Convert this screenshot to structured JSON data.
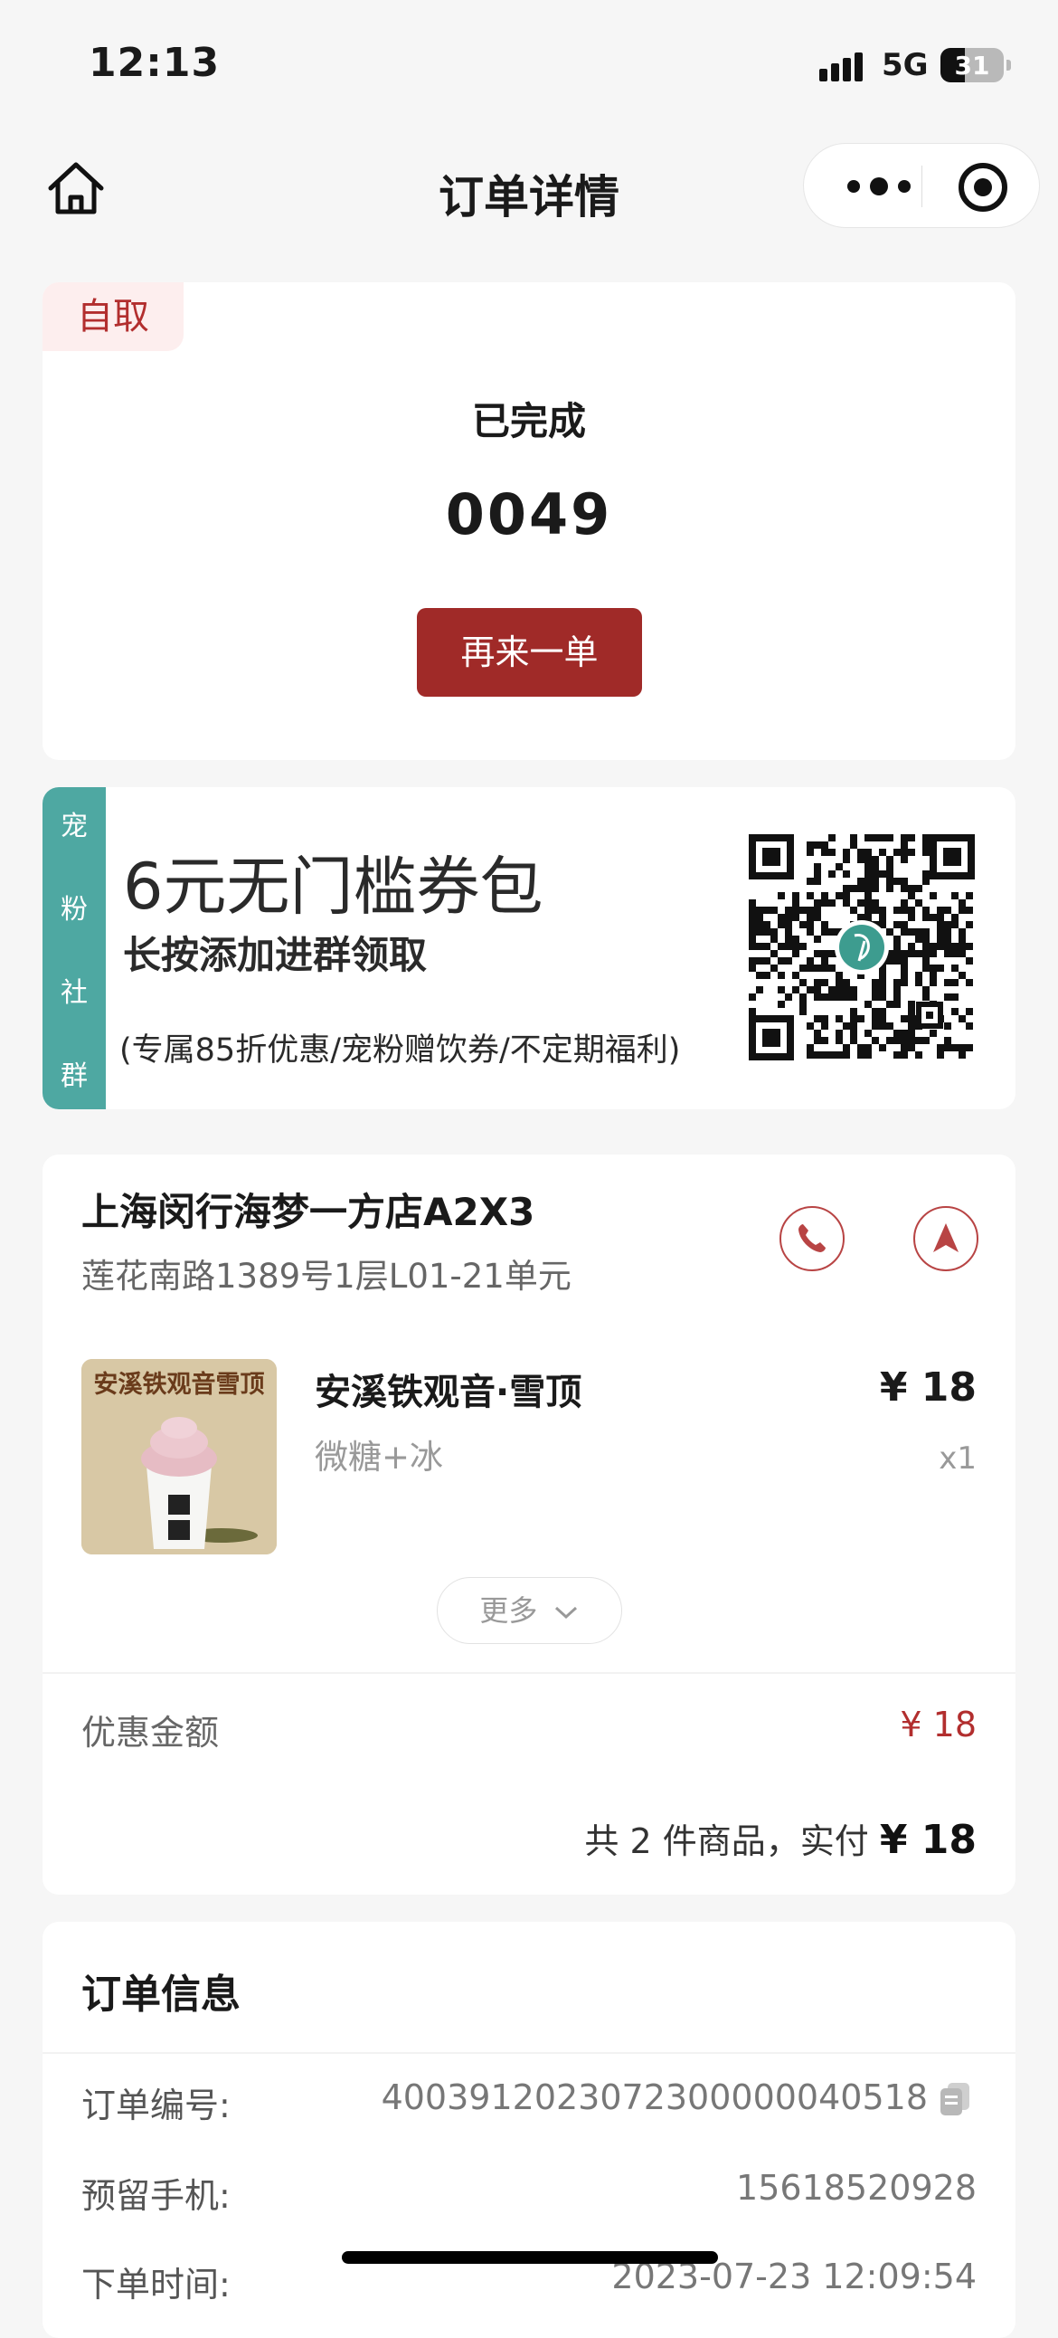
{
  "status_bar": {
    "time": "12:13",
    "network": "5G",
    "battery": "31"
  },
  "nav": {
    "title": "订单详情"
  },
  "order": {
    "pickup_tag": "自取",
    "status": "已完成",
    "number": "0049",
    "reorder_label": "再来一单"
  },
  "promo": {
    "side_chars": [
      "宠",
      "粉",
      "社",
      "群"
    ],
    "title": "6元无门槛券包",
    "subtitle": "长按添加进群领取",
    "note": "(专属85折优惠/宠粉赠饮券/不定期福利)",
    "accent_color": "#4ea8a2"
  },
  "store": {
    "name": "上海闵行海梦一方店A2X3",
    "address": "莲花南路1389号1层L01-21单元"
  },
  "product": {
    "image_text": "安溪铁观音雪顶",
    "name": "安溪铁观音·雪顶",
    "spec": "微糖+冰",
    "price": "¥ 18",
    "qty": "x1"
  },
  "more_label": "更多",
  "summary": {
    "discount_label": "优惠金额",
    "discount_value": "¥ 18",
    "total_prefix": "共 2 件商品，实付",
    "total_value": "¥ 18"
  },
  "info": {
    "title": "订单信息",
    "rows": [
      {
        "label": "订单编号:",
        "value": "4003912023072300000040518"
      },
      {
        "label": "预留手机:",
        "value": "15618520928"
      },
      {
        "label": "下单时间:",
        "value": "2023-07-23 12:09:54"
      }
    ]
  },
  "colors": {
    "brand": "#a02a28",
    "tag_bg": "#fdeeee"
  }
}
